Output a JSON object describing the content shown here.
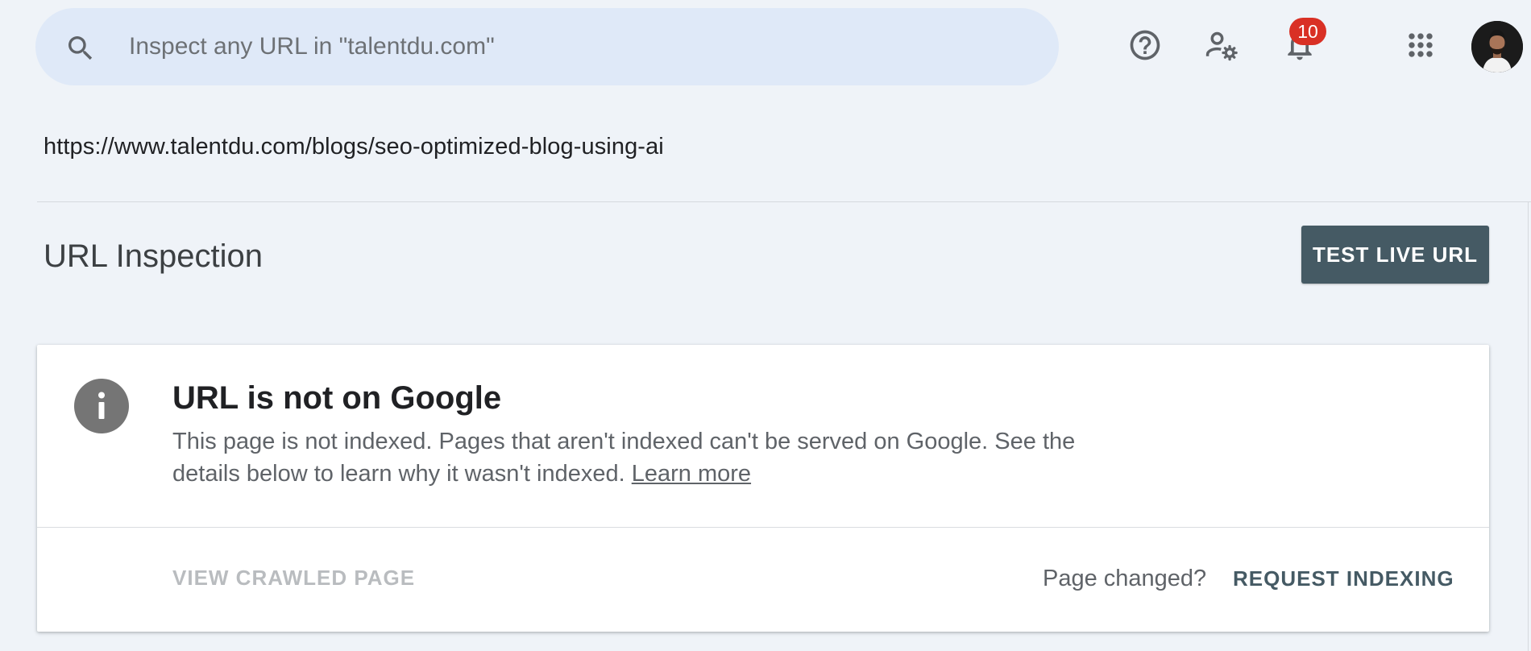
{
  "search": {
    "placeholder": "Inspect any URL in \"talentdu.com\"",
    "icon": "search-icon"
  },
  "header_icons": {
    "help": "help-icon",
    "admin": "admin-settings-icon",
    "notifications": "bell-icon",
    "notification_count": "10",
    "apps": "apps-grid-icon"
  },
  "inspected_url": "https://www.talentdu.com/blogs/seo-optimized-blog-using-ai",
  "section": {
    "title": "URL Inspection",
    "test_live_label": "TEST LIVE URL"
  },
  "status_card": {
    "icon": "info-icon",
    "title": "URL is not on Google",
    "description": "This page is not indexed. Pages that aren't indexed can't be served on Google. See the details below to learn why it wasn't indexed.",
    "learn_more": "Learn more",
    "view_crawled": "VIEW CRAWLED PAGE",
    "page_changed": "Page changed?",
    "request_indexing": "REQUEST INDEXING"
  },
  "colors": {
    "background": "#eff3f8",
    "search_bg": "#dfe9f8",
    "accent": "#455a64",
    "badge": "#d93025"
  }
}
